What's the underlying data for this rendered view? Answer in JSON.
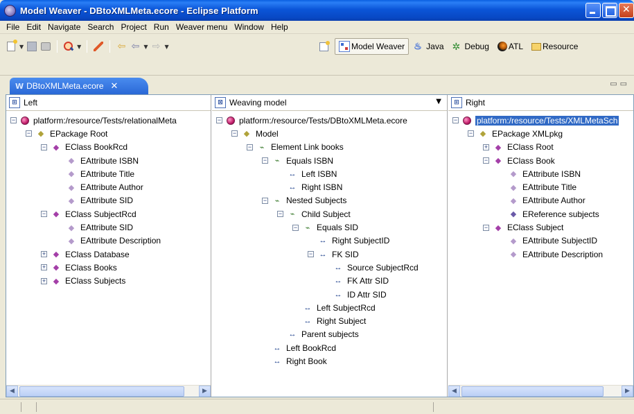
{
  "window": {
    "title": "Model Weaver - DBtoXMLMeta.ecore - Eclipse Platform"
  },
  "menubar": [
    "File",
    "Edit",
    "Navigate",
    "Search",
    "Project",
    "Run",
    "Weaver menu",
    "Window",
    "Help"
  ],
  "perspectives": [
    {
      "label": "Model Weaver",
      "icon": "model-weaver-icon",
      "active": true
    },
    {
      "label": "Java",
      "icon": "java-icon",
      "active": false
    },
    {
      "label": "Debug",
      "icon": "debug-icon",
      "active": false
    },
    {
      "label": "ATL",
      "icon": "atl-icon",
      "active": false
    },
    {
      "label": "Resource",
      "icon": "resource-icon",
      "active": false
    }
  ],
  "editor": {
    "tab_label": "DBtoXMLMeta.ecore",
    "tab_close": "✕"
  },
  "panels": {
    "left": {
      "title": "Left",
      "rows": [
        {
          "label": "platform:/resource/Tests/relationalMeta",
          "depth": 0,
          "toggle": "−",
          "icon": "resource-root-icon"
        },
        {
          "label": "EPackage Root",
          "depth": 1,
          "toggle": "−",
          "icon": "epackage-icon"
        },
        {
          "label": "EClass BookRcd",
          "depth": 2,
          "toggle": "−",
          "icon": "eclass-icon"
        },
        {
          "label": "EAttribute ISBN",
          "depth": 3,
          "toggle": "",
          "icon": "eattribute-icon"
        },
        {
          "label": "EAttribute Title",
          "depth": 3,
          "toggle": "",
          "icon": "eattribute-icon"
        },
        {
          "label": "EAttribute Author",
          "depth": 3,
          "toggle": "",
          "icon": "eattribute-icon"
        },
        {
          "label": "EAttribute SID",
          "depth": 3,
          "toggle": "",
          "icon": "eattribute-icon"
        },
        {
          "label": "EClass SubjectRcd",
          "depth": 2,
          "toggle": "−",
          "icon": "eclass-icon"
        },
        {
          "label": "EAttribute SID",
          "depth": 3,
          "toggle": "",
          "icon": "eattribute-icon"
        },
        {
          "label": "EAttribute Description",
          "depth": 3,
          "toggle": "",
          "icon": "eattribute-icon"
        },
        {
          "label": "EClass Database",
          "depth": 2,
          "toggle": "+",
          "icon": "eclass-icon"
        },
        {
          "label": "EClass Books",
          "depth": 2,
          "toggle": "+",
          "icon": "eclass-icon"
        },
        {
          "label": "EClass Subjects",
          "depth": 2,
          "toggle": "+",
          "icon": "eclass-icon"
        }
      ]
    },
    "middle": {
      "title": "Weaving model",
      "rows": [
        {
          "label": "platform:/resource/Tests/DBtoXMLMeta.ecore",
          "depth": 0,
          "toggle": "−",
          "icon": "resource-root-icon"
        },
        {
          "label": "Model",
          "depth": 1,
          "toggle": "−",
          "icon": "epackage-icon"
        },
        {
          "label": "Element Link books",
          "depth": 2,
          "toggle": "−",
          "icon": "link-icon"
        },
        {
          "label": "Equals ISBN",
          "depth": 3,
          "toggle": "−",
          "icon": "link-icon"
        },
        {
          "label": "Left ISBN",
          "depth": 4,
          "toggle": "",
          "icon": "link-end-icon"
        },
        {
          "label": "Right ISBN",
          "depth": 4,
          "toggle": "",
          "icon": "link-end-icon"
        },
        {
          "label": "Nested Subjects",
          "depth": 3,
          "toggle": "−",
          "icon": "link-icon"
        },
        {
          "label": "Child Subject",
          "depth": 4,
          "toggle": "−",
          "icon": "link-icon"
        },
        {
          "label": "Equals SID",
          "depth": 5,
          "toggle": "−",
          "icon": "link-icon"
        },
        {
          "label": "Right SubjectID",
          "depth": 6,
          "toggle": "",
          "icon": "link-end-icon"
        },
        {
          "label": "FK SID",
          "depth": 6,
          "toggle": "−",
          "icon": "link-end-icon"
        },
        {
          "label": "Source SubjectRcd",
          "depth": 7,
          "toggle": "",
          "icon": "link-end-icon"
        },
        {
          "label": "FK Attr SID",
          "depth": 7,
          "toggle": "",
          "icon": "link-end-icon"
        },
        {
          "label": "ID Attr SID",
          "depth": 7,
          "toggle": "",
          "icon": "link-end-icon"
        },
        {
          "label": "Left SubjectRcd",
          "depth": 5,
          "toggle": "",
          "icon": "link-end-icon"
        },
        {
          "label": "Right Subject",
          "depth": 5,
          "toggle": "",
          "icon": "link-end-icon"
        },
        {
          "label": "Parent subjects",
          "depth": 4,
          "toggle": "",
          "icon": "link-end-icon"
        },
        {
          "label": "Left BookRcd",
          "depth": 3,
          "toggle": "",
          "icon": "link-end-icon"
        },
        {
          "label": "Right Book",
          "depth": 3,
          "toggle": "",
          "icon": "link-end-icon"
        }
      ]
    },
    "right": {
      "title": "Right",
      "rows": [
        {
          "label": "platform:/resource/Tests/XMLMetaSch",
          "depth": 0,
          "toggle": "−",
          "icon": "resource-root-icon",
          "selected": true
        },
        {
          "label": "EPackage XMLpkg",
          "depth": 1,
          "toggle": "−",
          "icon": "epackage-icon"
        },
        {
          "label": "EClass Root",
          "depth": 2,
          "toggle": "+",
          "icon": "eclass-icon"
        },
        {
          "label": "EClass Book",
          "depth": 2,
          "toggle": "−",
          "icon": "eclass-icon"
        },
        {
          "label": "EAttribute ISBN",
          "depth": 3,
          "toggle": "",
          "icon": "eattribute-icon"
        },
        {
          "label": "EAttribute Title",
          "depth": 3,
          "toggle": "",
          "icon": "eattribute-icon"
        },
        {
          "label": "EAttribute Author",
          "depth": 3,
          "toggle": "",
          "icon": "eattribute-icon"
        },
        {
          "label": "EReference subjects",
          "depth": 3,
          "toggle": "",
          "icon": "ereference-icon"
        },
        {
          "label": "EClass Subject",
          "depth": 2,
          "toggle": "−",
          "icon": "eclass-icon"
        },
        {
          "label": "EAttribute SubjectID",
          "depth": 3,
          "toggle": "",
          "icon": "eattribute-icon"
        },
        {
          "label": "EAttribute Description",
          "depth": 3,
          "toggle": "",
          "icon": "eattribute-icon"
        }
      ]
    }
  },
  "colors": {
    "titlebar": "#0b55d8",
    "selection": "#316ac5",
    "eclass": "#a43fa8",
    "epackage": "#b0a33a",
    "link": "#3e7d32"
  }
}
